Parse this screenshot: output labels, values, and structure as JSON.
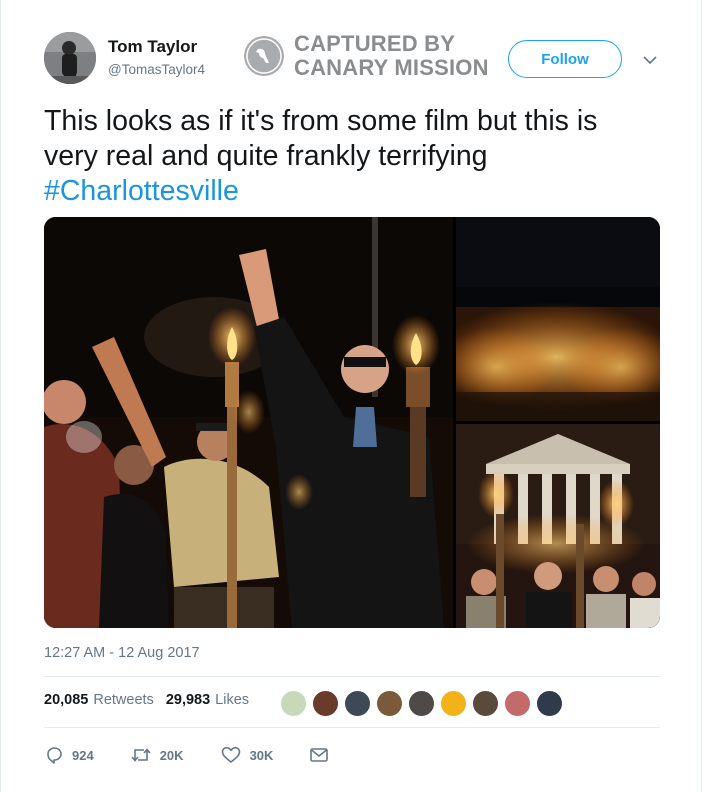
{
  "author": {
    "name": "Tom Taylor",
    "handle": "@TomasTaylor4"
  },
  "watermark": {
    "line1": "CAPTURED BY",
    "line2": "CANARY MISSION"
  },
  "follow_label": "Follow",
  "tweet": {
    "line1": "This looks as if it's from some film but this is",
    "line2": "very real and quite frankly terrifying",
    "hashtag": "#Charlottesville"
  },
  "timestamp": "12:27 AM - 12 Aug 2017",
  "stats": {
    "retweets_count": "20,085",
    "retweets_label": "Retweets",
    "likes_count": "29,983",
    "likes_label": "Likes"
  },
  "actions": {
    "reply_count": "924",
    "retweet_count": "20K",
    "like_count": "30K"
  },
  "colors": {
    "accent": "#1da1f2",
    "hashtag": "#1b95e0",
    "secondary_text": "#657786",
    "divider": "#e6ecf0"
  },
  "icons": [
    "caret-down-icon",
    "bird-icon",
    "reply-icon",
    "retweet-icon",
    "heart-icon",
    "message-icon"
  ]
}
